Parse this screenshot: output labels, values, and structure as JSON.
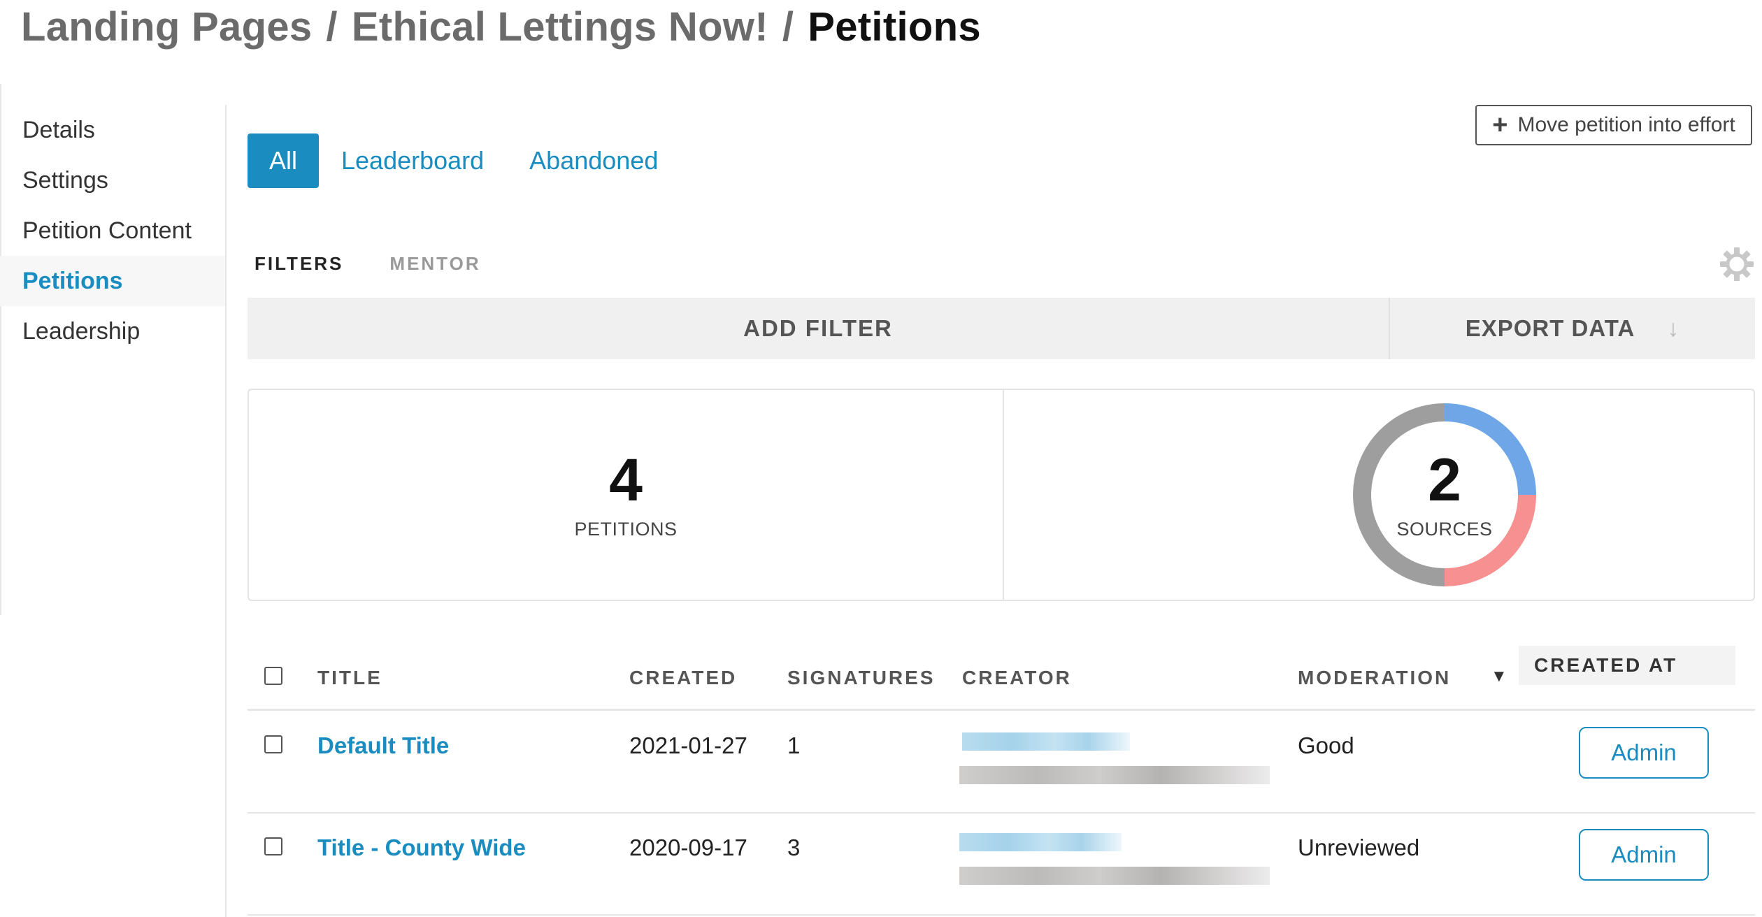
{
  "breadcrumb": {
    "part1": "Landing Pages",
    "sep": "/",
    "part2": "Ethical Lettings Now!",
    "current": "Petitions"
  },
  "sidebar": {
    "items": [
      {
        "label": "Details"
      },
      {
        "label": "Settings"
      },
      {
        "label": "Petition Content"
      },
      {
        "label": "Petitions",
        "active": true
      },
      {
        "label": "Leadership"
      }
    ]
  },
  "tabs": [
    {
      "label": "All",
      "active": true
    },
    {
      "label": "Leaderboard"
    },
    {
      "label": "Abandoned"
    }
  ],
  "move_button": {
    "label": "Move petition into effort",
    "icon": "plus-icon"
  },
  "subtabs": [
    {
      "label": "FILTERS",
      "active": true
    },
    {
      "label": "MENTOR"
    }
  ],
  "settings_icon": "gear-icon",
  "filter_bar": {
    "add_filter": "ADD FILTER",
    "export": "EXPORT DATA",
    "export_icon": "download-arrow-icon"
  },
  "stats": {
    "petitions": {
      "value": "4",
      "label": "PETITIONS"
    },
    "sources": {
      "value": "2",
      "label": "SOURCES",
      "segments": [
        {
          "color": "#6ea6e8",
          "fraction": 0.25
        },
        {
          "color": "#f79191",
          "fraction": 0.25
        },
        {
          "color": "#9e9e9e",
          "fraction": 0.5
        }
      ]
    }
  },
  "table": {
    "headers": {
      "title": "TITLE",
      "created": "CREATED",
      "signatures": "SIGNATURES",
      "creator": "CREATOR",
      "moderation": "MODERATION",
      "sort_indicator": "▼",
      "created_at": "CREATED AT"
    },
    "rows": [
      {
        "title": "Default Title",
        "created": "2021-01-27",
        "signatures": "1",
        "moderation": "Good",
        "action": "Admin"
      },
      {
        "title": "Title - County Wide",
        "created": "2020-09-17",
        "signatures": "3",
        "moderation": "Unreviewed",
        "action": "Admin"
      }
    ]
  },
  "colors": {
    "accent": "#1a8cbf",
    "donut_blue": "#6ea6e8",
    "donut_red": "#f79191",
    "donut_gray": "#9e9e9e"
  }
}
